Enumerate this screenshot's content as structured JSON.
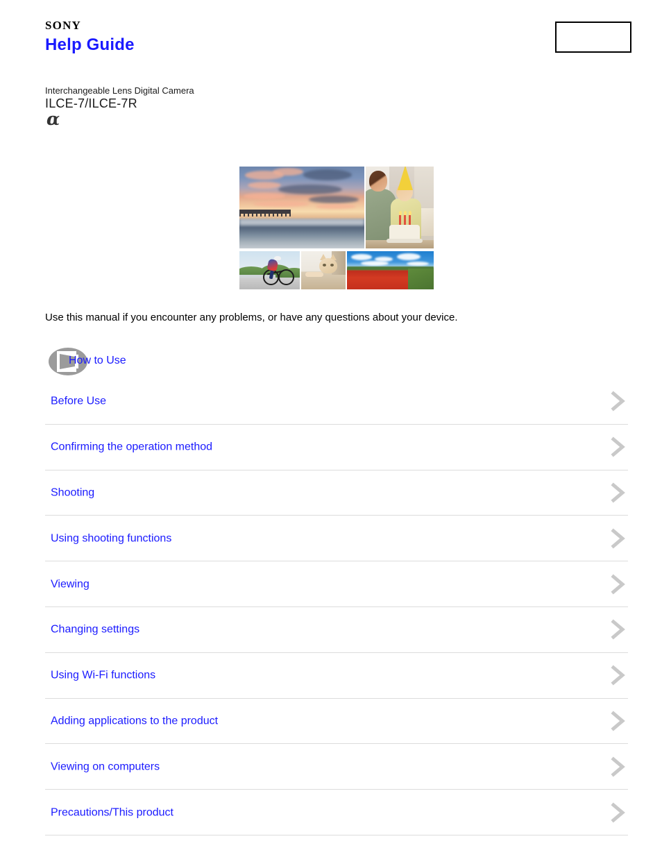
{
  "header": {
    "brand": "SONY",
    "title": "Help Guide",
    "top_right_box_label": "",
    "brand_color": "#000000",
    "title_color": "#1a1aff"
  },
  "product": {
    "category": "Interchangeable Lens Digital Camera",
    "model": "ILCE-7/ILCE-7R",
    "alpha_symbol": "α"
  },
  "collage": {
    "photos": [
      {
        "name": "sunset-beach-photo",
        "caption": "Sunset over beach with pier"
      },
      {
        "name": "birthday-party-photo",
        "caption": "Father and child with birthday cake"
      },
      {
        "name": "cyclist-photo",
        "caption": "Cyclist riding on coastal road"
      },
      {
        "name": "cat-photo",
        "caption": "Ginger cat peeking around a door"
      },
      {
        "name": "poppy-field-photo",
        "caption": "Red poppy field under blue sky"
      }
    ]
  },
  "lead": {
    "text": "Use this manual if you encounter any problems, or have any questions about your device."
  },
  "how_to_use": {
    "label": "How to Use",
    "icon": "camera-lens-icon",
    "icon_color": "#9b9b9b",
    "link_color": "#1a1aff"
  },
  "categories": {
    "chevron_icon": "chevron-right-icon",
    "chevron_color": "#c9c9c9",
    "separator_color": "#dcdcdc",
    "items": [
      {
        "label": "Before Use"
      },
      {
        "label": "Confirming the operation method"
      },
      {
        "label": "Shooting"
      },
      {
        "label": "Using shooting functions"
      },
      {
        "label": "Viewing"
      },
      {
        "label": "Changing settings"
      },
      {
        "label": "Using Wi-Fi functions"
      },
      {
        "label": "Adding applications to the product"
      },
      {
        "label": "Viewing on computers"
      },
      {
        "label": "Precautions/This product"
      }
    ]
  }
}
